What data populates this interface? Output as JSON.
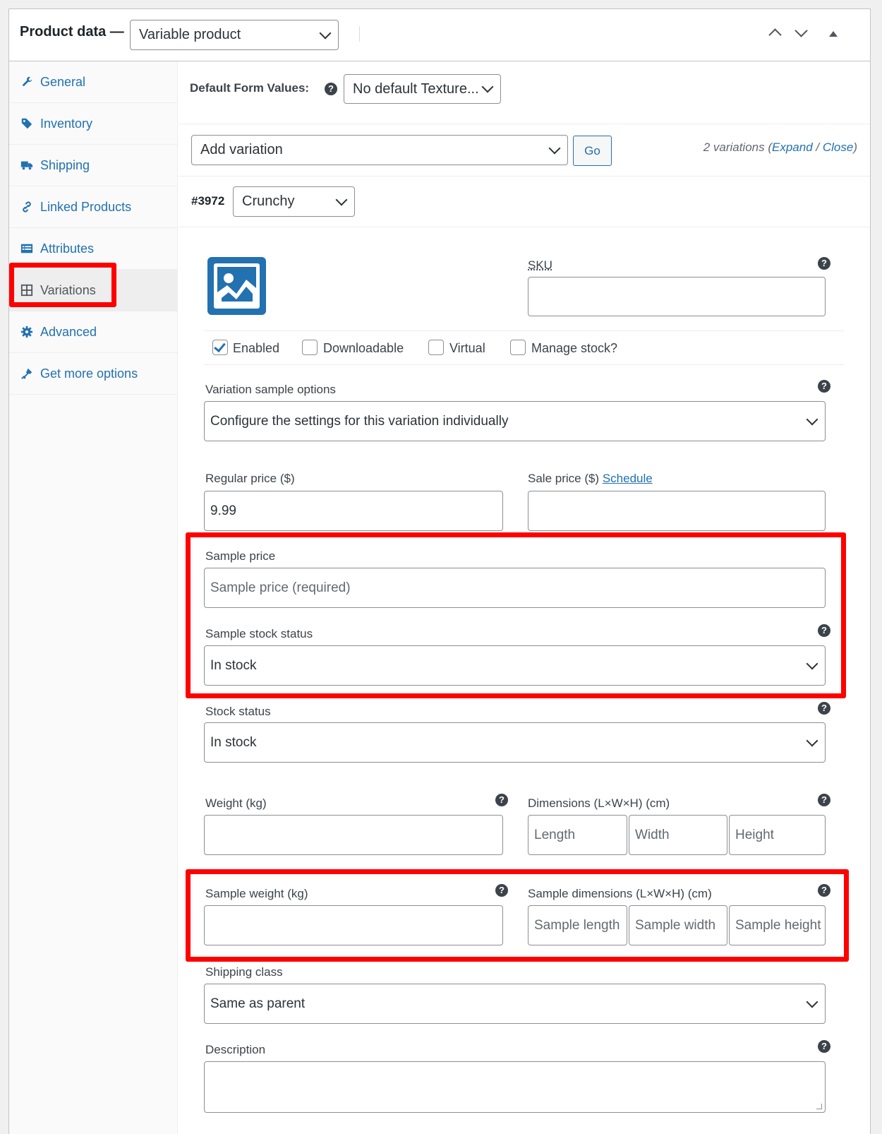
{
  "header": {
    "title": "Product data —",
    "product_type": "Variable product"
  },
  "sidebar": {
    "items": [
      {
        "label": "General",
        "icon": "wrench-icon"
      },
      {
        "label": "Inventory",
        "icon": "tag-icon"
      },
      {
        "label": "Shipping",
        "icon": "truck-icon"
      },
      {
        "label": "Linked Products",
        "icon": "link-icon"
      },
      {
        "label": "Attributes",
        "icon": "list-icon"
      },
      {
        "label": "Variations",
        "icon": "grid-icon"
      },
      {
        "label": "Advanced",
        "icon": "gear-icon"
      },
      {
        "label": "Get more options",
        "icon": "plugin-icon"
      }
    ],
    "active": "Variations"
  },
  "toolbar": {
    "default_form_label": "Default Form Values:",
    "default_form_value": "No default Texture...",
    "add_variation": "Add variation",
    "go": "Go",
    "count_text": "2 variations (",
    "expand": "Expand",
    "slash": " / ",
    "close": "Close",
    "close_paren": ")"
  },
  "variation": {
    "id": "#3972",
    "texture": "Crunchy",
    "sku_label": "SKU",
    "sku_value": "",
    "checkboxes": [
      {
        "label": "Enabled",
        "checked": true
      },
      {
        "label": "Downloadable",
        "checked": false
      },
      {
        "label": "Virtual",
        "checked": false
      },
      {
        "label": "Manage stock?",
        "checked": false
      }
    ],
    "sample_options_label": "Variation sample options",
    "sample_options_value": "Configure the settings for this variation individually",
    "regular_price_label": "Regular price ($)",
    "regular_price_value": "9.99",
    "sale_price_label": "Sale price ($) ",
    "schedule_link": "Schedule",
    "sample_price_label": "Sample price",
    "sample_price_placeholder": "Sample price (required)",
    "sample_stock_label": "Sample stock status",
    "sample_stock_value": "In stock",
    "stock_status_label": "Stock status",
    "stock_status_value": "In stock",
    "weight_label": "Weight (kg)",
    "dimensions_label": "Dimensions (L×W×H) (cm)",
    "length_ph": "Length",
    "width_ph": "Width",
    "height_ph": "Height",
    "sample_weight_label": "Sample weight (kg)",
    "sample_dimensions_label": "Sample dimensions (L×W×H) (cm)",
    "sample_length_ph": "Sample length",
    "sample_width_ph": "Sample width",
    "sample_height_ph": "Sample height",
    "shipping_class_label": "Shipping class",
    "shipping_class_value": "Same as parent",
    "description_label": "Description",
    "description_value": ""
  },
  "help_glyph": "?",
  "colors": {
    "highlight": "#ff0000",
    "link": "#2271b1",
    "image_placeholder": "#2271b1"
  }
}
